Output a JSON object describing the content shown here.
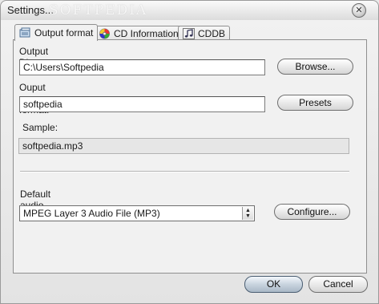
{
  "window": {
    "title": "Settings...",
    "watermark": "SOFTPEDIA"
  },
  "tabs": [
    {
      "label": "Output format",
      "icon": "output-format-icon",
      "active": true
    },
    {
      "label": "CD Information",
      "icon": "cd-icon",
      "active": false
    },
    {
      "label": "CDDB",
      "icon": "music-note-icon",
      "active": false
    }
  ],
  "output_directory": {
    "label": "Output Directory:",
    "value": "C:\\Users\\Softpedia",
    "browse_label": "Browse..."
  },
  "name_format": {
    "label": "Ouput name format:",
    "value": "softpedia",
    "presets_label": "Presets"
  },
  "sample": {
    "label": "Sample:",
    "value": "softpedia.mp3"
  },
  "audio_format": {
    "label": "Default audio format:",
    "selected": "MPEG Layer 3 Audio File (MP3)",
    "configure_label": "Configure..."
  },
  "buttons": {
    "ok": "OK",
    "cancel": "Cancel"
  }
}
